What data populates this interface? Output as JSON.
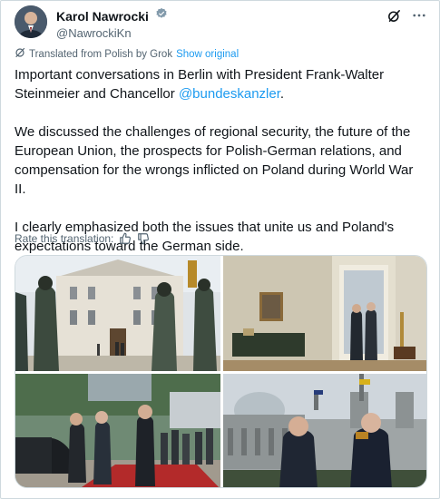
{
  "author": {
    "display_name": "Karol Nawrocki",
    "handle": "@NawrockiKn"
  },
  "translation": {
    "note": "Translated from Polish by Grok",
    "show_original": "Show original",
    "rate_label": "Rate this translation:"
  },
  "tweet": {
    "p1_before": "Important conversations in Berlin with President Frank-Walter Steinmeier and Chancellor ",
    "p1_mention": "@bundeskanzler",
    "p1_after": ".",
    "p2": "We discussed the challenges of regional security, the future of the European Union, the prospects for Polish-German relations, and compensation for the wrongs inflicted on Poland during World War II.",
    "p3": "I clearly emphasized both the issues that unite us and Poland's expectations toward the German side."
  },
  "colors": {
    "accent": "#1d9bf0",
    "secondary_text": "#536471",
    "text": "#0f1419",
    "border": "#cfd9de"
  },
  "icons": [
    "verified-badge-icon",
    "grok-icon",
    "more-icon",
    "translate-icon",
    "thumbs-up-icon",
    "thumbs-down-icon"
  ],
  "media": {
    "photo_count": 4
  }
}
